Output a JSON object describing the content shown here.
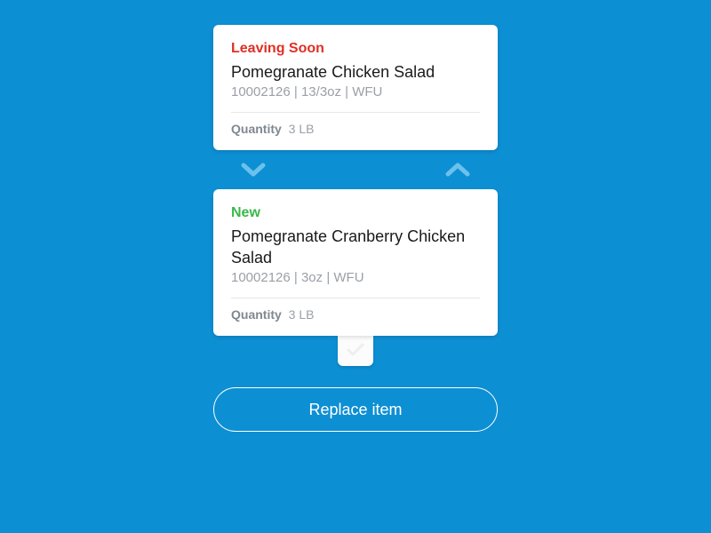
{
  "leaving": {
    "status": "Leaving Soon",
    "title": "Pomegranate Chicken Salad",
    "meta": "10002126 | 13/3oz | WFU",
    "qty_label": "Quantity",
    "qty_value": "3 LB"
  },
  "new_item": {
    "status": "New",
    "title": "Pomegranate Cranberry Chicken Salad",
    "meta": "10002126 | 3oz | WFU",
    "qty_label": "Quantity",
    "qty_value": "3 LB"
  },
  "button": {
    "replace": "Replace item"
  }
}
